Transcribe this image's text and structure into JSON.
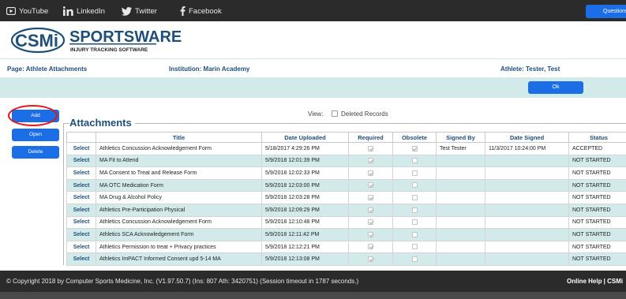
{
  "social": {
    "youtube": "YouTube",
    "linkedin": "LinkedIn",
    "twitter": "Twitter",
    "facebook": "Facebook",
    "questions_label": "Questions"
  },
  "logo": {
    "csmi": "CSMi",
    "sportsware": "SPORTSWARE",
    "tagline": "INJURY TRACKING SOFTWARE"
  },
  "info": {
    "page": "Page: Athlete Attachments",
    "institution": "Institution: Marin Academy",
    "athlete": "Athlete: Tester, Test"
  },
  "buttons": {
    "ok": "Ok",
    "add": "Add",
    "open": "Open",
    "delete": "Delete"
  },
  "view": {
    "label": "View:",
    "deleted_records": "Deleted Records"
  },
  "section_title": "Attachments",
  "table": {
    "headers": [
      "Title",
      "Date Uploaded",
      "Required",
      "Obsolete",
      "Signed By",
      "Date Signed",
      "Status"
    ],
    "rows": [
      {
        "select": "Select",
        "title": "Athletics Concussion Acknowledgement Form",
        "uploaded": "5/18/2017 4:29:26 PM",
        "required": true,
        "obsolete": true,
        "signed_by": "Test Tester",
        "signed": "11/3/2017 10:24:00 PM",
        "status": "ACCEPTED"
      },
      {
        "select": "Select",
        "title": "MA Fit to Attend",
        "uploaded": "5/9/2018 12:01:39 PM",
        "required": true,
        "obsolete": false,
        "signed_by": "",
        "signed": "",
        "status": "NOT STARTED"
      },
      {
        "select": "Select",
        "title": "MA Consent to Treat and Release Form",
        "uploaded": "5/9/2018 12:02:33 PM",
        "required": true,
        "obsolete": false,
        "signed_by": "",
        "signed": "",
        "status": "NOT STARTED"
      },
      {
        "select": "Select",
        "title": "MA OTC Medication Form",
        "uploaded": "5/9/2018 12:03:00 PM",
        "required": true,
        "obsolete": false,
        "signed_by": "",
        "signed": "",
        "status": "NOT STARTED"
      },
      {
        "select": "Select",
        "title": "MA Drug & Alcohol Policy",
        "uploaded": "5/9/2018 12:03:28 PM",
        "required": true,
        "obsolete": false,
        "signed_by": "",
        "signed": "",
        "status": "NOT STARTED"
      },
      {
        "select": "Select",
        "title": "Athletics Pre-Participation Physical",
        "uploaded": "5/9/2018 12:09:29 PM",
        "required": true,
        "obsolete": false,
        "signed_by": "",
        "signed": "",
        "status": "NOT STARTED"
      },
      {
        "select": "Select",
        "title": "Athletics Concussion Acknowledgement Form",
        "uploaded": "5/9/2018 12:10:48 PM",
        "required": true,
        "obsolete": false,
        "signed_by": "",
        "signed": "",
        "status": "NOT STARTED"
      },
      {
        "select": "Select",
        "title": "Athletics SCA Acknowledgement Form",
        "uploaded": "5/9/2018 12:11:42 PM",
        "required": true,
        "obsolete": false,
        "signed_by": "",
        "signed": "",
        "status": "NOT STARTED"
      },
      {
        "select": "Select",
        "title": "Athletics Permission to treat + Privacy practices",
        "uploaded": "5/9/2018 12:12:21 PM",
        "required": true,
        "obsolete": false,
        "signed_by": "",
        "signed": "",
        "status": "NOT STARTED"
      },
      {
        "select": "Select",
        "title": "Athletics ImPACT Informed Consent upd 5-14 MA",
        "uploaded": "5/9/2018 12:13:08 PM",
        "required": true,
        "obsolete": false,
        "signed_by": "",
        "signed": "",
        "status": "NOT STARTED"
      }
    ]
  },
  "footer": {
    "copyright": "© Copyright 2018 by Computer Sports Medicine, Inc. (V1.97.50.7) (Ins: 807 Ath: 3420751) (Session timeout in 1787 seconds.)",
    "help": "Online Help  |  CSMi"
  },
  "colors": {
    "accent": "#1b6ee6",
    "navy": "#1f4e79",
    "teal_row": "#d2ebea",
    "dark_bar": "#2b2b2b",
    "highlight": "#e4141b"
  }
}
